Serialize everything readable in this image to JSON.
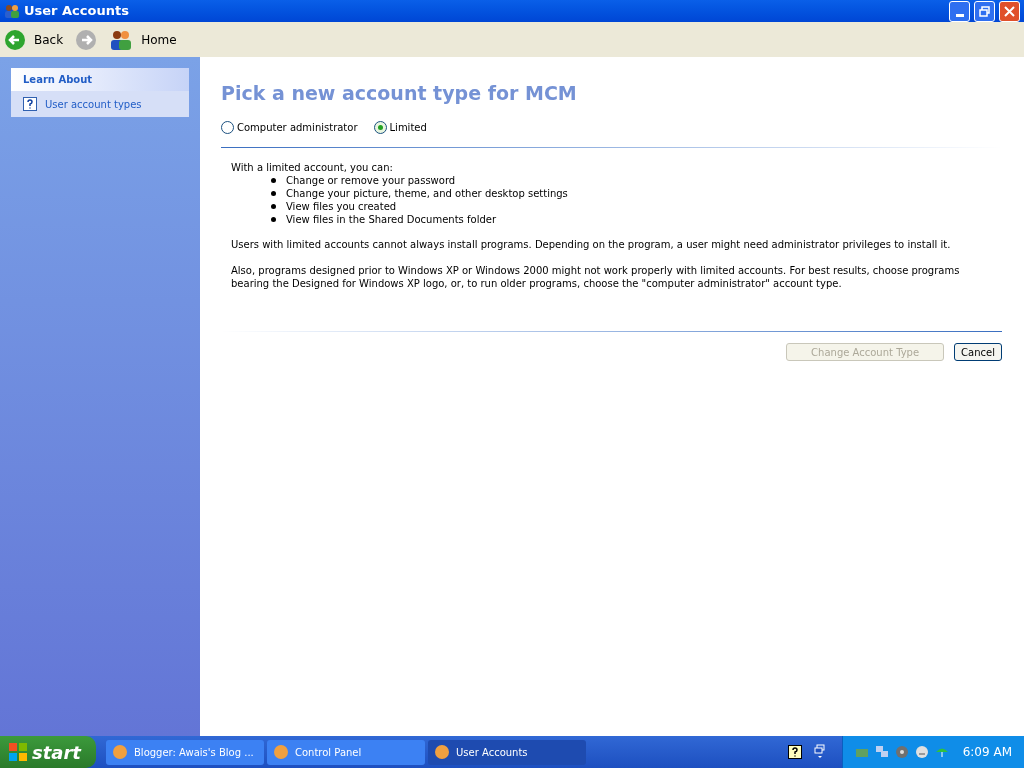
{
  "window": {
    "title": "User Accounts"
  },
  "toolbar": {
    "back": {
      "label": "Back"
    },
    "forward": {
      "disabled": true
    },
    "home": {
      "label": "Home"
    }
  },
  "sidebar": {
    "title": "Learn About",
    "items": [
      {
        "label": "User account types"
      }
    ]
  },
  "content": {
    "heading": "Pick a new account type for MCM",
    "options": [
      {
        "label": "Computer administrator",
        "selected": false
      },
      {
        "label": "Limited",
        "selected": true
      }
    ],
    "intro": "With a limited account, you can:",
    "bullets": [
      "Change or remove your password",
      "Change your picture, theme, and other desktop settings",
      "View files you created",
      "View files in the Shared Documents folder"
    ],
    "paragraphs": [
      "Users with limited accounts cannot always install programs. Depending on the program, a user might need administrator privileges to install it.",
      "Also, programs designed prior to Windows XP or Windows 2000 might not work properly with limited accounts. For best results, choose programs bearing the Designed for Windows XP logo, or, to run older programs, choose the \"computer administrator\" account type."
    ],
    "buttons": [
      {
        "label": "Change Account Type",
        "disabled": true
      },
      {
        "label": "Cancel",
        "disabled": false
      }
    ]
  },
  "taskbar": {
    "start": "start",
    "tasks": [
      {
        "label": "Blogger: Awais's Blog ...",
        "selected": false
      },
      {
        "label": "Control Panel",
        "selected": false
      },
      {
        "label": "User Accounts",
        "selected": true
      }
    ],
    "clock": "6:09 AM"
  }
}
